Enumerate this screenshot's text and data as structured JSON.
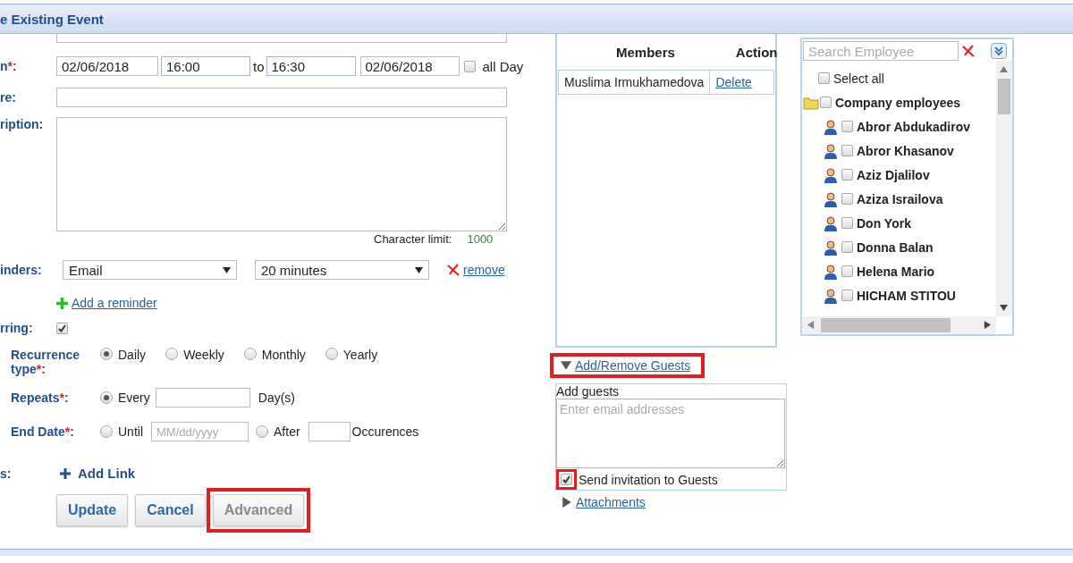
{
  "window": {
    "title": "e Existing Event"
  },
  "form": {
    "time": {
      "label": {
        "before": "n",
        "required": "*",
        "after": ":"
      },
      "start_date": "02/06/2018",
      "start_time": "16:00",
      "to": "to",
      "end_time": "16:30",
      "end_date": "02/06/2018",
      "all_day": {
        "label": "all Day",
        "checked": false
      }
    },
    "location": {
      "label": {
        "before": "re:"
      }
    },
    "description": {
      "label": {
        "before": "ription:"
      },
      "limit_label": "Character limit:",
      "limit": "1000"
    },
    "reminders": {
      "label": {
        "before": "inders:"
      },
      "items": [
        {
          "method": "Email",
          "before": "20 minutes",
          "remove": "remove"
        }
      ],
      "add": "Add a reminder"
    },
    "recurring": {
      "label": {
        "before": "rring:"
      },
      "checked": true
    },
    "recurrence_type": {
      "label": {
        "before": "Recurrence type",
        "required": "*",
        "after": ":"
      },
      "options": [
        {
          "label": "Daily",
          "selected": true
        },
        {
          "label": "Weekly",
          "selected": false
        },
        {
          "label": "Monthly",
          "selected": false
        },
        {
          "label": "Yearly",
          "selected": false
        }
      ]
    },
    "repeats": {
      "label": {
        "before": "Repeats",
        "required": "*",
        "after": ":"
      },
      "option": {
        "label": "Every",
        "selected": true
      },
      "unit": "Day(s)"
    },
    "end_date": {
      "label": {
        "before": "End Date",
        "required": "*",
        "after": ":"
      },
      "until": {
        "label": "Until",
        "selected": false,
        "placeholder": "MM/dd/yyyy"
      },
      "after": {
        "label": "After",
        "selected": false
      },
      "unit": "Occurences"
    },
    "links": {
      "label": {
        "before": "s:"
      },
      "add": "Add Link"
    },
    "buttons": [
      {
        "label": "Update",
        "disabled": false,
        "highlighted": false
      },
      {
        "label": "Cancel",
        "disabled": false,
        "highlighted": false
      },
      {
        "label": "Advanced",
        "disabled": true,
        "highlighted": true
      }
    ]
  },
  "members": {
    "columns": [
      "Members",
      "Action"
    ],
    "rows": [
      {
        "name": "Muslima Irmukhamedova",
        "action": "Delete"
      }
    ]
  },
  "guests": {
    "toggle": {
      "label": "Add/Remove Guests",
      "expanded": true,
      "highlighted": true
    },
    "title": "Add guests",
    "placeholder": "Enter email addresses",
    "send": {
      "label": "Send invitation to Guests",
      "checked": true,
      "highlighted": true
    }
  },
  "attachments": {
    "label": "Attachments",
    "expanded": false
  },
  "employees": {
    "search_placeholder": "Search Employee",
    "select_all": {
      "label": "Select all",
      "checked": false
    },
    "group": {
      "label": "Company employees",
      "checked": false,
      "children": [
        {
          "label": "Abror Abdukadirov",
          "checked": false
        },
        {
          "label": "Abror Khasanov",
          "checked": false
        },
        {
          "label": "Aziz Djalilov",
          "checked": false
        },
        {
          "label": "Aziza Israilova",
          "checked": false
        },
        {
          "label": "Don York",
          "checked": false
        },
        {
          "label": "Donna Balan",
          "checked": false
        },
        {
          "label": "Helena Mario",
          "checked": false
        },
        {
          "label": "HICHAM STITOU",
          "checked": false
        }
      ]
    }
  }
}
